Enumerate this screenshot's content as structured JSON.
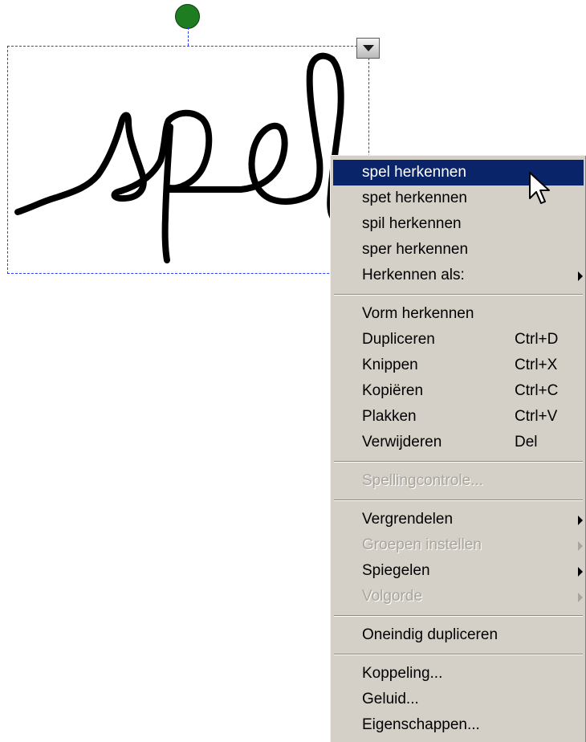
{
  "canvas": {
    "rotate_handle_color": "#1e7d21",
    "selection_color": "#2a3dff",
    "object_menu_icon": "triangle-down-icon"
  },
  "context_menu": {
    "recognize_group": [
      {
        "label": "spel herkennen",
        "highlighted": true
      },
      {
        "label": "spet herkennen"
      },
      {
        "label": "spil herkennen"
      },
      {
        "label": "sper herkennen"
      },
      {
        "label": "Herkennen als:",
        "submenu": true
      }
    ],
    "edit_group": [
      {
        "label": "Vorm herkennen",
        "shortcut": ""
      },
      {
        "label": "Dupliceren",
        "shortcut": "Ctrl+D"
      },
      {
        "label": "Knippen",
        "shortcut": "Ctrl+X"
      },
      {
        "label": "Kopiëren",
        "shortcut": "Ctrl+C"
      },
      {
        "label": "Plakken",
        "shortcut": "Ctrl+V"
      },
      {
        "label": "Verwijderen",
        "shortcut": "Del"
      }
    ],
    "spelling_group": [
      {
        "label": "Spellingcontrole...",
        "disabled": true
      }
    ],
    "arrange_group": [
      {
        "label": "Vergrendelen",
        "submenu": true
      },
      {
        "label": "Groepen instellen",
        "submenu": true,
        "disabled": true
      },
      {
        "label": "Spiegelen",
        "submenu": true
      },
      {
        "label": "Volgorde",
        "submenu": true,
        "disabled": true
      }
    ],
    "clone_group": [
      {
        "label": "Oneindig dupliceren"
      }
    ],
    "link_group": [
      {
        "label": "Koppeling..."
      },
      {
        "label": "Geluid..."
      },
      {
        "label": "Eigenschappen..."
      }
    ],
    "highlight_color": "#0a246a",
    "background_color": "#d4d0c8"
  },
  "cursor": {
    "icon": "arrow-pointer-icon"
  }
}
